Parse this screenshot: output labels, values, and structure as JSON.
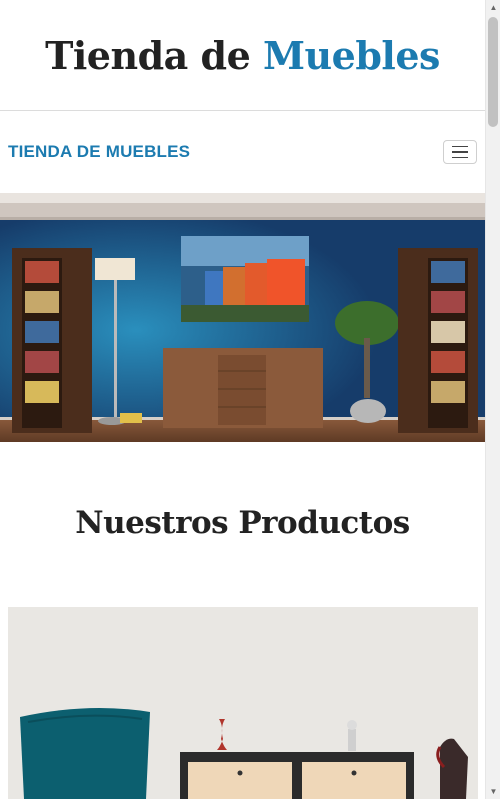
{
  "header": {
    "title_main": "Tienda de",
    "title_accent": "Muebles"
  },
  "navbar": {
    "brand": "TIENDA DE MUEBLES",
    "toggle_icon": "hamburger-menu-icon"
  },
  "hero": {
    "image_label": "living-room-furniture"
  },
  "products": {
    "section_title": "Nuestros Productos"
  },
  "colors": {
    "accent": "#1c7bb0",
    "text": "#222222",
    "wall": "#1b3f6e"
  }
}
